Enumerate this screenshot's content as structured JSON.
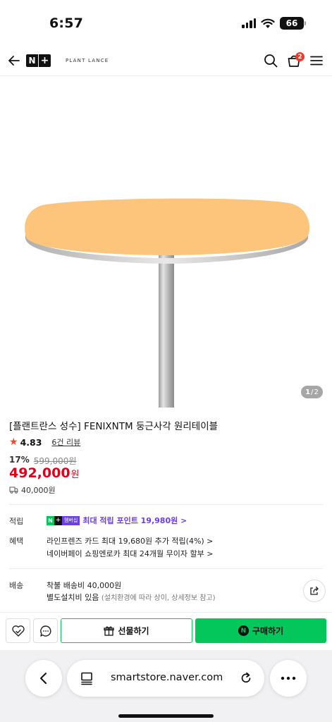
{
  "status": {
    "time": "6:57",
    "battery": "66"
  },
  "header": {
    "brand": "PLANT LANCE",
    "logo_n": "N",
    "logo_plus": "+",
    "cart_count": "2"
  },
  "gallery": {
    "current": "1",
    "separator": "/",
    "total": "2"
  },
  "product": {
    "title": "[플랜트란스 성수] FENIXNTM 둥근사각 원리테이블",
    "rating": "4.83",
    "reviews": "6건 리뷰",
    "discount": "17%",
    "original_price": "599,000원",
    "sale_price": "492,000",
    "currency": "원",
    "shipping_summary": "40,000원"
  },
  "details": {
    "points_label": "적립",
    "member_badge": "멤버십",
    "points_text": "최대 적립 포인트 19,980원 >",
    "benefit_label": "혜택",
    "benefits": [
      "라인프렌즈 카드 최대 19,680원 추가 적립(4%) >",
      "네이버페이 쇼핑엔로카 최대 24개월 무이자 할부 >"
    ],
    "delivery_label": "배송",
    "delivery_lines": [
      "착불 배송비 40,000원",
      "별도설치비 있음"
    ],
    "delivery_note": "(설치환경에 따라 상이, 상세정보 참고)"
  },
  "actions": {
    "gift": "선물하기",
    "buy": "구매하기",
    "npay": "N"
  },
  "browser": {
    "url": "smartstore.naver.com"
  },
  "colors": {
    "accent": "#03c75a",
    "price": "#e0001b",
    "points": "#6b3fe3",
    "table_top": "#fdc57b"
  }
}
